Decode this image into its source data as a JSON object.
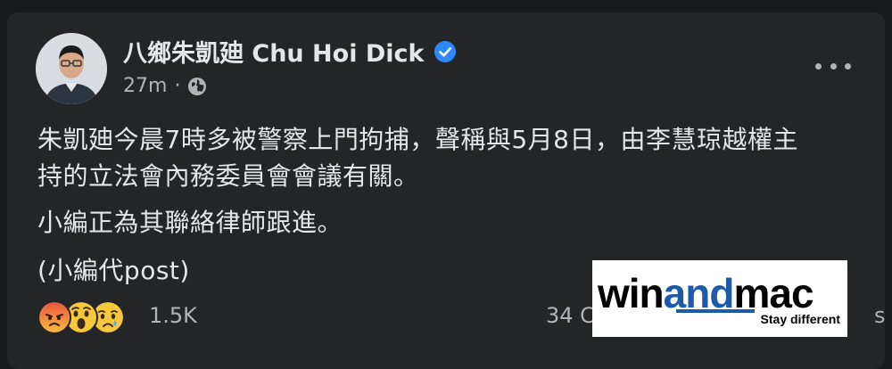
{
  "post": {
    "author": "八鄉朱凱廸 Chu Hoi Dick",
    "timestamp": "27m",
    "separator": "·",
    "lines": [
      "朱凱廸今晨7時多被警察上門拘捕，聲稱與5月8日，由李慧琼越權主",
      "持的立法會內務委員會會議有關。",
      "小編正為其聯絡律師跟進。",
      "(小編代post)"
    ],
    "reaction_count": "1.5K",
    "comments_partial": "34 C",
    "comments_tail": "s",
    "reactions": [
      "angry",
      "wow",
      "sad"
    ]
  },
  "watermark": {
    "part1": "win",
    "part2": "and",
    "part3": "mac",
    "tagline": "Stay different"
  },
  "colors": {
    "background": "#18191a",
    "card": "#242526",
    "text": "#e4e6eb",
    "secondary": "#b0b3b8",
    "verified": "#2d88ff",
    "watermark_accent": "#1f5aa8"
  }
}
